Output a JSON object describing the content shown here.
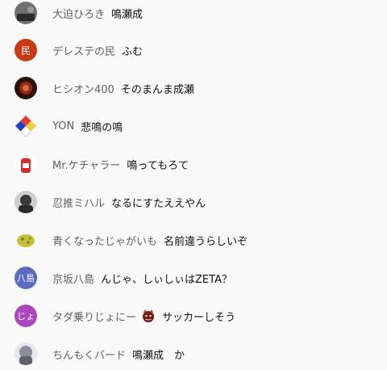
{
  "chat": {
    "messages": [
      {
        "author": "大迫ひろき",
        "message": "鳴瀬成",
        "avatar_text": "",
        "avatar_color": "#7a7a7a"
      },
      {
        "author": "デレステの民",
        "message": "ふむ",
        "avatar_text": "民",
        "avatar_color": "#c73a14"
      },
      {
        "author": "ヒシオン400",
        "message": "そのまんま成瀬",
        "avatar_text": "",
        "avatar_color": "#3b1a12"
      },
      {
        "author": "YON",
        "message": "悲鳴の鳴",
        "avatar_text": "",
        "avatar_color": "#1f3aa8"
      },
      {
        "author": "Mr.ケチャラー",
        "message": "鳴ってもろて",
        "avatar_text": "",
        "avatar_color": "#d92b2b"
      },
      {
        "author": "忍推ミハル",
        "message": "なるにすたええやん",
        "avatar_text": "",
        "avatar_color": "#444444"
      },
      {
        "author": "青くなったじゃがいも",
        "message": "名前違うらしいぞ",
        "avatar_text": "",
        "avatar_color": "#c9c238"
      },
      {
        "author": "京坂八島",
        "message": "んじゃ、しぃしぃはZETA？",
        "avatar_text": "八島",
        "avatar_color": "#5c6bc0"
      },
      {
        "author": "タダ乗りじょにー",
        "message": "サッカーしそう",
        "avatar_text": "じょ",
        "avatar_color": "#ab47bc"
      },
      {
        "author": "ちんもくバード",
        "message": "鳴瀬成　か",
        "avatar_text": "",
        "avatar_color": "#8d8d99"
      }
    ]
  }
}
